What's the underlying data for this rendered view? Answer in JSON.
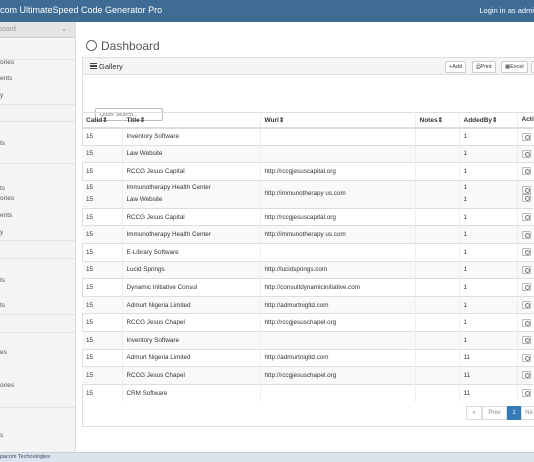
{
  "topbar": {
    "brand": "com UltimateSpeed Code Generator Pro",
    "login": "Login in as admi"
  },
  "sidebar": {
    "top_label": "board",
    "items": [
      "ories",
      "ents",
      "y",
      "ts",
      "ts",
      "ories",
      "ents",
      "y",
      "ts",
      "ts",
      "es",
      "ories",
      "s"
    ]
  },
  "footer": {
    "text": "pacom Technologies"
  },
  "page": {
    "title": "Dashboard"
  },
  "panel": {
    "title": "Gallery",
    "buttons": {
      "add": "Add",
      "print": "Print",
      "excel": "Excel"
    },
    "search_placeholder": "Quick Search..."
  },
  "table": {
    "headers": [
      "Catid",
      "Title",
      "Wurl",
      "Notes",
      "AddedBy",
      "Actio"
    ],
    "rows": [
      {
        "catid": "15",
        "title": "Inventory Software",
        "wurl": "",
        "notes": "",
        "addedby": "1"
      },
      {
        "catid": "15",
        "title": "Law Website",
        "wurl": "",
        "notes": "",
        "addedby": "1"
      },
      {
        "catid": "15",
        "title": "RCCG Jesus Capital",
        "wurl": "http://rccgjesuscapital.org",
        "notes": "",
        "addedby": "1"
      },
      {
        "catid": "15",
        "title": "Immunotherapy Health Center",
        "wurl": "http://immunotherapy us.com",
        "notes": "",
        "addedby": "1",
        "catid2": "15",
        "title2": "Law Website",
        "addedby2": "1"
      },
      {
        "catid": "15",
        "title": "RCCG Jesus Capital",
        "wurl": "http://rccgjesuscapital.org",
        "notes": "",
        "addedby": "1"
      },
      {
        "catid": "15",
        "title": "Immunotherapy Health Center",
        "wurl": "http://immunotherapy us.com",
        "notes": "",
        "addedby": "1"
      },
      {
        "catid": "15",
        "title": "E-Library Software",
        "wurl": "",
        "notes": "",
        "addedby": "1"
      },
      {
        "catid": "15",
        "title": "Lucid Springs",
        "wurl": "http://lucidsprings.com",
        "notes": "",
        "addedby": "1"
      },
      {
        "catid": "15",
        "title": "Dynamic Initiative Consul",
        "wurl": "http://consultdynamicinitiative.com",
        "notes": "",
        "addedby": "1"
      },
      {
        "catid": "15",
        "title": "Admurt Nigeria Limited",
        "wurl": "http://admurtnigltd.com",
        "notes": "",
        "addedby": "1"
      },
      {
        "catid": "15",
        "title": "RCCG Jesus Chapel",
        "wurl": "http://rccgjesuschapel.org",
        "notes": "",
        "addedby": "1"
      },
      {
        "catid": "15",
        "title": "Inventory Software",
        "wurl": "",
        "notes": "",
        "addedby": "1"
      },
      {
        "catid": "15",
        "title": "Admurt Nigeria Limited",
        "wurl": "http://admurtnigltd.com",
        "notes": "",
        "addedby": "11"
      },
      {
        "catid": "15",
        "title": "RCCG Jesus Chapel",
        "wurl": "http://rccgjesuschapel.org",
        "notes": "",
        "addedby": "11"
      },
      {
        "catid": "15",
        "title": "CRM Software",
        "wurl": "",
        "notes": "",
        "addedby": "11"
      }
    ]
  },
  "pagination": {
    "first": "«",
    "prev": "Prev",
    "current": "1",
    "next": "Ne"
  },
  "colors": {
    "topbar": "#3e6c95",
    "pager_active": "#337ab7"
  }
}
